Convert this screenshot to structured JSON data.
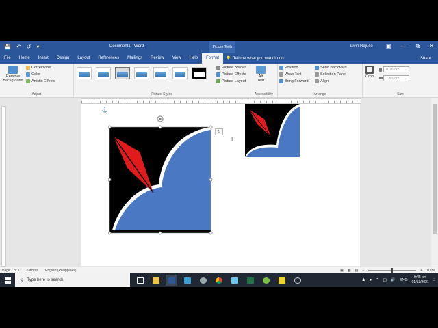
{
  "app": {
    "window_title": "Document1  -  Word",
    "context_tab": "Picture Tools",
    "user_name": "Livin Rejuso"
  },
  "tabs": [
    "File",
    "Home",
    "Insert",
    "Design",
    "Layout",
    "References",
    "Mailings",
    "Review",
    "View",
    "Help",
    "Format"
  ],
  "active_tab": "Format",
  "tell_me": "Tell me what you want to do",
  "share": "Share",
  "ribbon": {
    "adjust": {
      "remove_background": "Remove Background",
      "corrections": "Corrections",
      "color": "Color",
      "artistic_effects": "Artistic Effects",
      "label": "Adjust"
    },
    "picture_styles": {
      "label": "Picture Styles",
      "border": "Picture Border",
      "effects": "Picture Effects",
      "layout": "Picture Layout"
    },
    "accessibility": {
      "alt_text": "Alt Text",
      "label": "Accessibility"
    },
    "arrange": {
      "position": "Position",
      "wrap_text": "Wrap Text",
      "bring_forward": "Bring Forward",
      "send_backward": "Send Backward",
      "selection_pane": "Selection Pane",
      "align": "Align",
      "label": "Arrange"
    },
    "size": {
      "crop": "Crop",
      "height": "8.18 cm",
      "width": "7.83 cm",
      "label": "Size"
    }
  },
  "status": {
    "page": "Page 1 of 1",
    "words": "0 words",
    "language": "English (Philippines)",
    "zoom": "100%"
  },
  "taskbar": {
    "search_placeholder": "Type here to search",
    "lang": "ENG",
    "time": "9:45 pm",
    "date": "01/13/2021"
  },
  "colors": {
    "word_blue": "#2b579a",
    "shape_blue": "#4a78c2",
    "shape_red": "#e01b1b",
    "shape_black": "#000000"
  }
}
